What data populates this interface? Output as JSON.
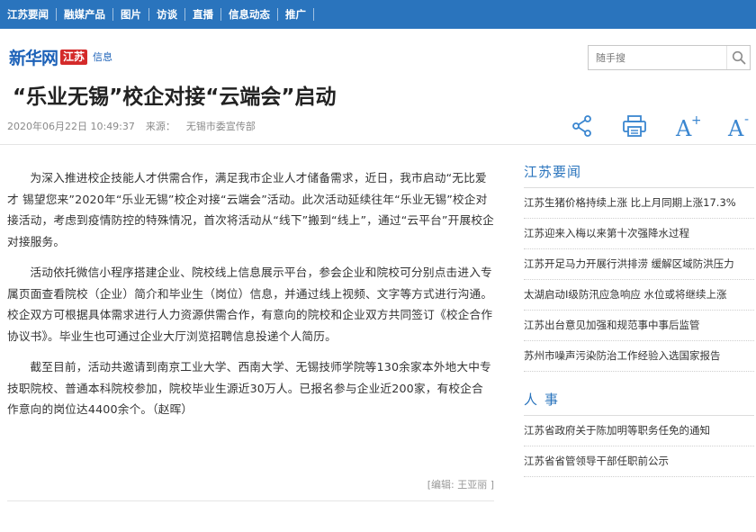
{
  "topnav": {
    "items": [
      "江苏要闻",
      "融媒产品",
      "图片",
      "访谈",
      "直播",
      "信息动态",
      "推广"
    ]
  },
  "logo": {
    "main": "新华网",
    "badge": "江苏",
    "sub": "信息"
  },
  "search": {
    "placeholder": "随手搜",
    "icon": "search-icon"
  },
  "article": {
    "title": "“乐业无锡”校企对接“云端会”启动",
    "datetime": "2020年06月22日 10:49:37",
    "source_label": "来源：",
    "source": "无锡市委宣传部",
    "paragraphs": [
      "为深入推进校企技能人才供需合作，满足我市企业人才储备需求，近日，我市启动“无比爱才 锡望您来”2020年“乐业无锡”校企对接“云端会”活动。此次活动延续往年“乐业无锡”校企对接活动，考虑到疫情防控的特殊情况，首次将活动从“线下”搬到“线上”，通过“云平台”开展校企对接服务。",
      "活动依托微信小程序搭建企业、院校线上信息展示平台，参会企业和院校可分别点击进入专属页面查看院校（企业）简介和毕业生（岗位）信息，并通过线上视频、文字等方式进行沟通。校企双方可根据具体需求进行人力资源供需合作，有意向的院校和企业双方共同签订《校企合作协议书》。毕业生也可通过企业大厅浏览招聘信息投递个人简历。",
      "截至目前，活动共邀请到南京工业大学、西南大学、无锡技师学院等130余家本外地大中专技职院校、普通本科院校参加，院校毕业生源近30万人。已报名参与企业近200家，有校企合作意向的岗位达4400余个。（赵晖）"
    ],
    "editor": "[编辑: 王亚丽 ]"
  },
  "tools": {
    "share": "share-icon",
    "print": "print-icon",
    "font_up": "A",
    "font_up_mark": "+",
    "font_down": "A",
    "font_down_mark": "-"
  },
  "sidebar": {
    "section1_title": "江苏要闻",
    "section1_items": [
      "江苏生猪价格持续上涨 比上月同期上涨17.3%",
      "江苏迎来入梅以来第十次强降水过程",
      "江苏开足马力开展行洪排涝 缓解区域防洪压力",
      "太湖启动Ⅰ级防汛应急响应 水位或将继续上涨",
      "江苏出台意见加强和规范事中事后监管",
      "苏州市噪声污染防治工作经验入选国家报告"
    ],
    "section2_title": "人事",
    "section2_items": [
      "江苏省政府关于陈加明等职务任免的通知",
      "江苏省省管领导干部任职前公示"
    ]
  },
  "colors": {
    "nav_blue": "#2a74bd",
    "logo_blue": "#1d62b8",
    "badge_red": "#d42a2a",
    "tool_blue": "#3a86d0"
  }
}
